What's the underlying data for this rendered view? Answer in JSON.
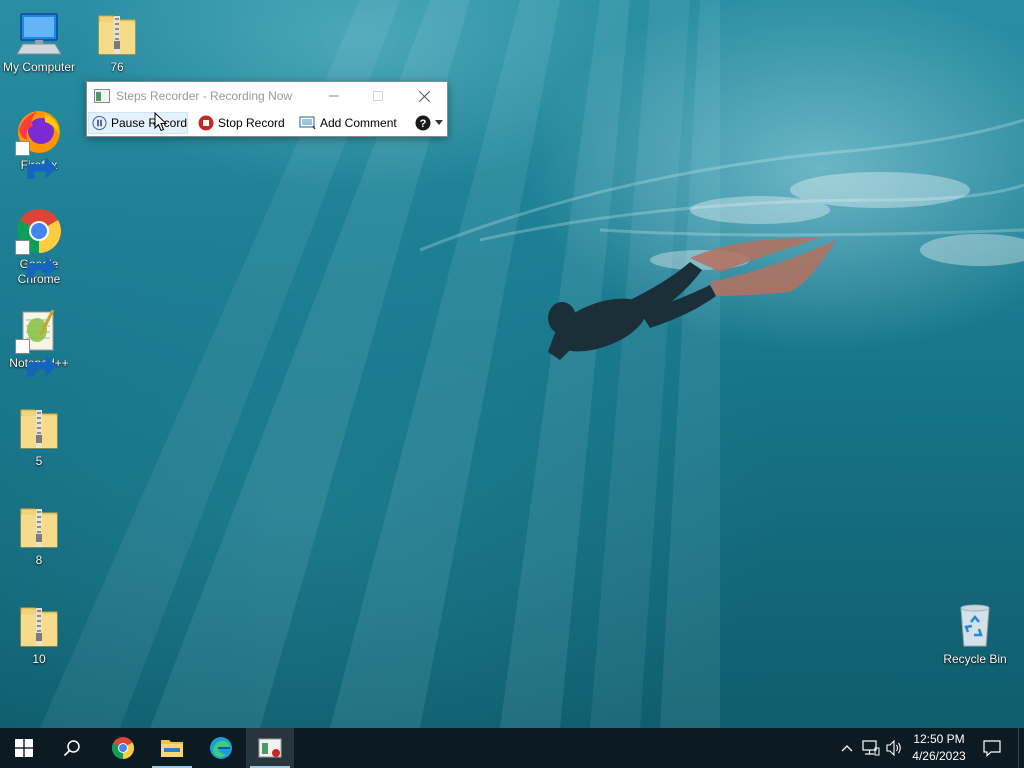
{
  "desktop": {
    "icons": [
      {
        "label": "My Computer",
        "icon": "computer-icon"
      },
      {
        "label": "76",
        "icon": "zip-folder-icon"
      },
      {
        "label": "Firefox",
        "icon": "firefox-icon"
      },
      {
        "label": "Google Chrome",
        "icon": "chrome-icon"
      },
      {
        "label": "Notepad++",
        "icon": "notepadpp-icon"
      },
      {
        "label": "5",
        "icon": "zip-folder-icon"
      },
      {
        "label": "8",
        "icon": "zip-folder-icon"
      },
      {
        "label": "10",
        "icon": "zip-folder-icon"
      },
      {
        "label": "Recycle Bin",
        "icon": "recycle-bin-icon"
      }
    ]
  },
  "recorder": {
    "title": "Steps Recorder - Recording Now",
    "pause_label": "Pause Record",
    "stop_label": "Stop Record",
    "comment_label": "Add Comment",
    "colors": {
      "stop": "#c62828",
      "pause": "#2a5d8f"
    }
  },
  "taskbar": {
    "items": [
      "start-icon",
      "search-icon",
      "chrome-icon",
      "file-explorer-icon",
      "edge-icon",
      "steps-recorder-icon"
    ]
  },
  "tray": {
    "time": "12:50 PM",
    "date": "4/26/2023"
  },
  "colors": {
    "taskbar": "#0c1a22",
    "accent": "#9cc9e8"
  }
}
